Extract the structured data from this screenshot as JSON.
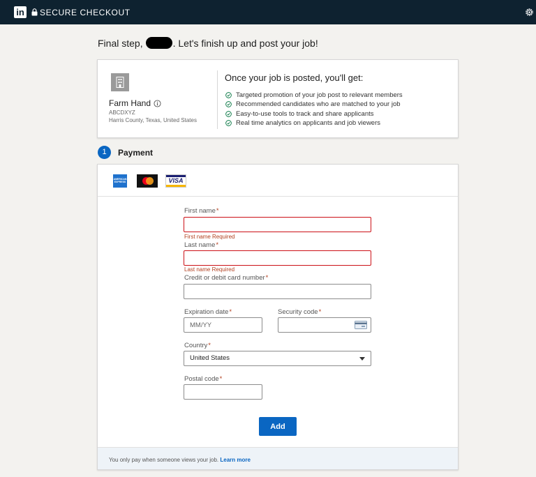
{
  "topbar": {
    "logo_text": "in",
    "title": "SECURE CHECKOUT"
  },
  "greeting": {
    "prefix": "Final step,",
    "suffix": ". Let's finish up and post your job!"
  },
  "job": {
    "title": "Farm Hand",
    "company": "ABCDXYZ",
    "location": "Harris County, Texas, United States"
  },
  "benefits": {
    "title": "Once your job is posted, you'll get:",
    "items": [
      "Targeted promotion of your job post to relevant members",
      "Recommended candidates who are matched to your job",
      "Easy-to-use tools to track and share applicants",
      "Real time analytics on applicants and job viewers"
    ]
  },
  "payment": {
    "step_number": "1",
    "title": "Payment",
    "card_brands": {
      "amex": "AMERICAN EXPRESS",
      "visa": "VISA"
    }
  },
  "form": {
    "first_name": {
      "label": "First name",
      "value": "",
      "error": "First name Required"
    },
    "last_name": {
      "label": "Last name",
      "value": "",
      "error": "Last name Required"
    },
    "card_number": {
      "label": "Credit or debit card number",
      "value": ""
    },
    "expiration": {
      "label": "Expiration date",
      "placeholder": "MM/YY"
    },
    "security_code": {
      "label": "Security code",
      "value": ""
    },
    "country": {
      "label": "Country",
      "selected": "United States"
    },
    "postal_code": {
      "label": "Postal code",
      "value": ""
    },
    "required_mark": "*",
    "add_label": "Add"
  },
  "footer": {
    "text": "You only pay when someone views your job.",
    "link": "Learn more"
  },
  "colors": {
    "topbar": "#0e2230",
    "accent": "#0a66c2",
    "error": "#cc1016"
  }
}
